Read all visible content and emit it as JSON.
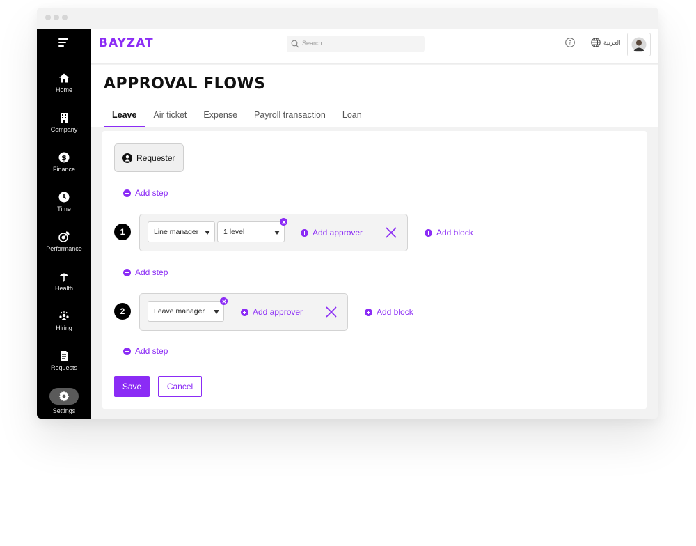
{
  "brand": {
    "logo": "BAYZAT",
    "accent": "#8b2cf5"
  },
  "topbar": {
    "search_placeholder": "Search",
    "language_label": "العربية"
  },
  "sidebar": {
    "items": [
      {
        "label": "Home",
        "icon": "home-icon"
      },
      {
        "label": "Company",
        "icon": "building-icon"
      },
      {
        "label": "Finance",
        "icon": "dollar-icon"
      },
      {
        "label": "Time",
        "icon": "clock-icon"
      },
      {
        "label": "Performance",
        "icon": "target-icon"
      },
      {
        "label": "Health",
        "icon": "umbrella-icon"
      },
      {
        "label": "Hiring",
        "icon": "people-icon"
      },
      {
        "label": "Requests",
        "icon": "document-icon"
      },
      {
        "label": "Settings",
        "icon": "gear-icon",
        "active": true
      }
    ]
  },
  "page": {
    "title": "APPROVAL FLOWS",
    "tabs": [
      {
        "label": "Leave",
        "active": true
      },
      {
        "label": "Air ticket"
      },
      {
        "label": "Expense"
      },
      {
        "label": "Payroll transaction"
      },
      {
        "label": "Loan"
      }
    ]
  },
  "flow": {
    "requester_label": "Requester",
    "add_step_label": "Add step",
    "add_approver_label": "Add approver",
    "add_block_label": "Add block",
    "steps": [
      {
        "number": "1",
        "approvers": [
          {
            "role": "Line manager",
            "levels": "1 level"
          }
        ]
      },
      {
        "number": "2",
        "approvers": [
          {
            "role": "Leave manager"
          }
        ]
      }
    ]
  },
  "actions": {
    "save_label": "Save",
    "cancel_label": "Cancel"
  }
}
